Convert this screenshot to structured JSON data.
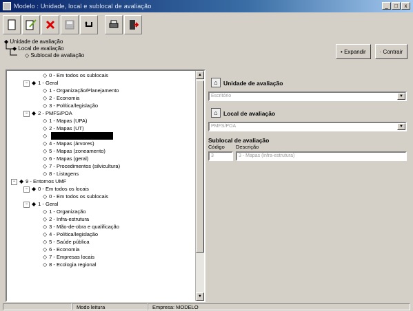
{
  "window": {
    "title": "Modelo : Unidade, local e sublocal de avaliação",
    "buttons": [
      "_",
      "□",
      "x"
    ]
  },
  "toolbar": {
    "icons": [
      "new-icon",
      "edit-icon",
      "delete-icon",
      "save-icon",
      "undo-icon",
      "print-icon",
      "exit-icon"
    ]
  },
  "breadcrumb": {
    "level1": "Unidade de avaliação",
    "level2": "Local de avaliação",
    "level3": "Sublocal de avaliação"
  },
  "actions": {
    "expand": "• Expandir",
    "contract": "· Contrair"
  },
  "tree": {
    "lines": [
      {
        "exp": "",
        "text": "0 - Em todos os sublocais"
      },
      {
        "exp": "−",
        "text": "1 - Geral"
      },
      {
        "exp": "",
        "text": "1 - Organização/Planejamento"
      },
      {
        "exp": "",
        "text": "2 - Economia"
      },
      {
        "exp": "",
        "text": "3 - Política/legislação"
      },
      {
        "exp": "−",
        "text": "2 - PMFS/POA"
      },
      {
        "exp": "",
        "text": "1 - Mapas (UPA)"
      },
      {
        "exp": "",
        "text": "2 - Mapas (UT)"
      },
      {
        "exp": "",
        "text": ""
      },
      {
        "exp": "",
        "text": "4 - Mapas (árvores)"
      },
      {
        "exp": "",
        "text": "5 - Mapas (zoneamento)"
      },
      {
        "exp": "",
        "text": "6 - Mapas (geral)"
      },
      {
        "exp": "",
        "text": "7 - Procedimentos (silvicultura)"
      },
      {
        "exp": "",
        "text": "8 - Listagens"
      },
      {
        "exp": "−",
        "text": "9 - Entornos UMF"
      },
      {
        "exp": "−",
        "text": "0 - Em todos os locais"
      },
      {
        "exp": "",
        "text": "0 - Em todos os sublocais"
      },
      {
        "exp": "−",
        "text": "1 - Geral"
      },
      {
        "exp": "",
        "text": "1 - Organização"
      },
      {
        "exp": "",
        "text": "2 - Infra-estrutura"
      },
      {
        "exp": "",
        "text": "3 - Mão-de-obra e qualificação"
      },
      {
        "exp": "",
        "text": "4 - Política/legislação"
      },
      {
        "exp": "",
        "text": "5 - Saúde pública"
      },
      {
        "exp": "",
        "text": "6 - Economia"
      },
      {
        "exp": "",
        "text": "7 - Empresas locais"
      },
      {
        "exp": "",
        "text": "8 - Ecologia regional"
      }
    ]
  },
  "form": {
    "unit_label": "Unidade de avaliação",
    "unit_value": "Escritório",
    "local_label": "Local de avaliação",
    "local_value": "PMFS/POA",
    "sublocal_label": "Sublocal de avaliação",
    "code_label": "Código",
    "desc_label": "Descrição",
    "code_value": "3",
    "desc_value": "3 - Mapas (infra-estrutura)"
  },
  "status": {
    "mode": "Modo leitura",
    "company": "Empresa: MODELO"
  }
}
